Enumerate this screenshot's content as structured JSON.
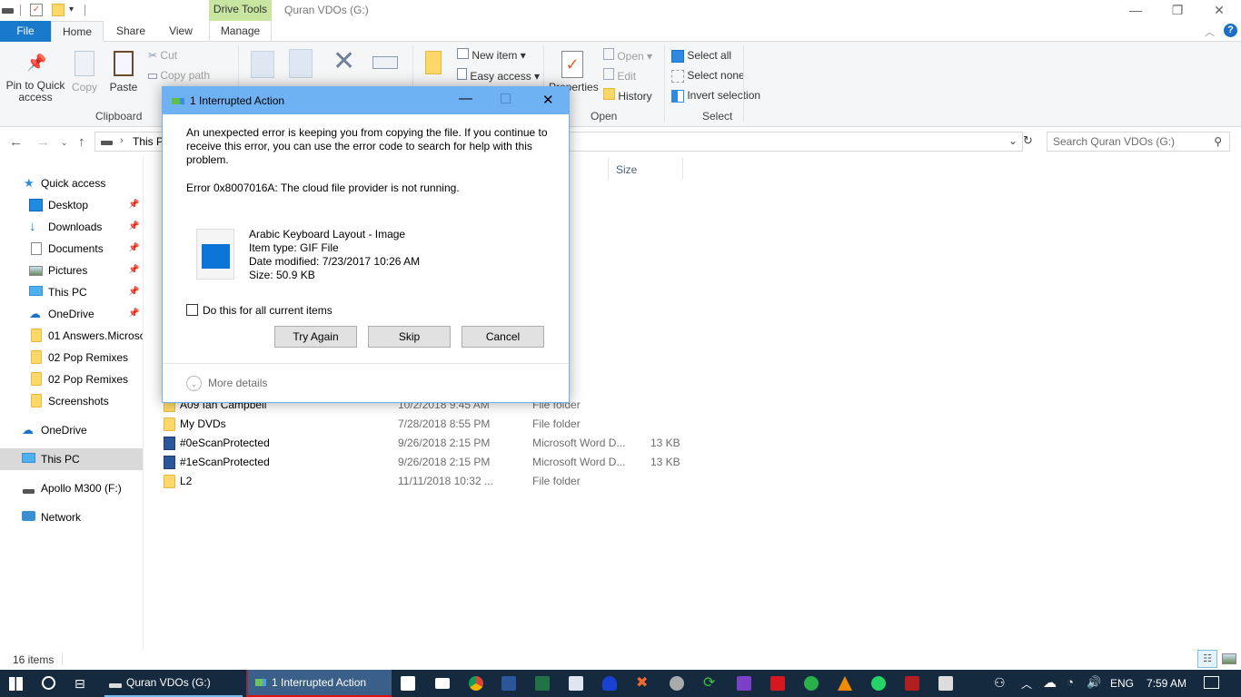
{
  "window": {
    "title": "Quran VDOs (G:)",
    "context_tab_group": "Drive Tools",
    "controls": {
      "minimize": "—",
      "restore": "❐",
      "close": "✕"
    }
  },
  "ribbon_tabs": [
    {
      "label": "File"
    },
    {
      "label": "Home"
    },
    {
      "label": "Share"
    },
    {
      "label": "View"
    },
    {
      "label": "Manage"
    }
  ],
  "ribbon": {
    "clipboard": {
      "pin_label_1": "Pin to Quick",
      "pin_label_2": "access",
      "copy": "Copy",
      "paste": "Paste",
      "cut": "Cut",
      "copy_path": "Copy path",
      "group": "Clipboard"
    },
    "organize": {
      "move": "Move",
      "copy": "Copy",
      "delete": "Delete",
      "rename": "Rename"
    },
    "new": {
      "new_folder": "New",
      "new_item": "New item",
      "easy_access": "Easy access"
    },
    "open": {
      "properties": "Properties",
      "open": "Open",
      "edit": "Edit",
      "history": "History",
      "group": "Open"
    },
    "select": {
      "select_all": "Select all",
      "select_none": "Select none",
      "invert": "Invert selection",
      "group": "Select"
    }
  },
  "nav": {
    "address_crumb": "This PC",
    "search_placeholder": "Search Quran VDOs (G:)"
  },
  "sidebar": {
    "items": [
      {
        "label": "Quick access",
        "icon": "star-icon"
      },
      {
        "label": "Desktop",
        "icon": "desktop-icon",
        "pinned": true
      },
      {
        "label": "Downloads",
        "icon": "download-icon",
        "pinned": true
      },
      {
        "label": "Documents",
        "icon": "documents-icon",
        "pinned": true
      },
      {
        "label": "Pictures",
        "icon": "pictures-icon",
        "pinned": true
      },
      {
        "label": "This PC",
        "icon": "computer-icon",
        "pinned": true
      },
      {
        "label": "OneDrive",
        "icon": "cloud-icon",
        "pinned": true
      },
      {
        "label": "01 Answers.Microsc",
        "icon": "folder-icon"
      },
      {
        "label": "02 Pop Remixes",
        "icon": "folder-icon"
      },
      {
        "label": "02 Pop Remixes",
        "icon": "folder-icon"
      },
      {
        "label": "Screenshots",
        "icon": "folder-icon"
      },
      {
        "label": "OneDrive",
        "icon": "cloud-icon"
      },
      {
        "label": "This PC",
        "icon": "computer-icon",
        "selected": true
      },
      {
        "label": "Apollo M300 (F:)",
        "icon": "drive-icon"
      },
      {
        "label": "Network",
        "icon": "network-icon"
      }
    ]
  },
  "filelist": {
    "columns": {
      "size": "Size"
    },
    "rows": [
      {
        "name": "A09 Ian Campbell",
        "date": "10/2/2018 9:45 AM",
        "type": "File folder",
        "size": "",
        "kind": "folder"
      },
      {
        "name": "My DVDs",
        "date": "7/28/2018 8:55 PM",
        "type": "File folder",
        "size": "",
        "kind": "folder"
      },
      {
        "name": "#0eScanProtected",
        "date": "9/26/2018 2:15 PM",
        "type": "Microsoft Word D...",
        "size": "13 KB",
        "kind": "word"
      },
      {
        "name": "#1eScanProtected",
        "date": "9/26/2018 2:15 PM",
        "type": "Microsoft Word D...",
        "size": "13 KB",
        "kind": "word"
      },
      {
        "name": "L2",
        "date": "11/11/2018 10:32 ...",
        "type": "File folder",
        "size": "",
        "kind": "folder"
      }
    ]
  },
  "status": {
    "count": "16 items"
  },
  "dialog": {
    "title": "1 Interrupted Action",
    "message": "An unexpected error is keeping you from copying the file. If you continue to receive this error, you can use the error code to search for help with this problem.",
    "error": "Error 0x8007016A: The cloud file provider is not running.",
    "file": {
      "name": "Arabic Keyboard Layout - Image",
      "type": "Item type: GIF File",
      "modified": "Date modified: 7/23/2017 10:26 AM",
      "size": "Size: 50.9 KB"
    },
    "checkbox_label": "Do this for all current items",
    "checkbox_checked": false,
    "buttons": {
      "try_again": "Try Again",
      "skip": "Skip",
      "cancel": "Cancel"
    },
    "more_details": "More details"
  },
  "taskbar": {
    "apps": [
      {
        "label": "Quran VDOs (G:)"
      },
      {
        "label": "1 Interrupted Action"
      }
    ],
    "pinned": [
      "store-icon",
      "mail-icon",
      "chrome-icon",
      "word-icon",
      "excel-icon",
      "font-app-icon",
      "audio-app-icon",
      "x-app-icon",
      "disc-app-icon",
      "sync-icon",
      "visual-studio-icon",
      "acrobat-icon",
      "green-app-icon",
      "vlc-icon",
      "whatsapp-icon",
      "red-app-icon",
      "panda-icon"
    ],
    "tray": {
      "language": "ENG",
      "time": "7:59 AM"
    }
  }
}
